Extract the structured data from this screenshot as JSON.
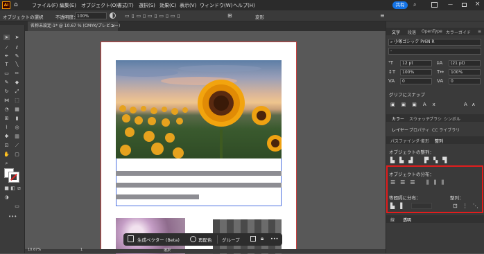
{
  "menu": {
    "app_icon": "Ai",
    "items": [
      "ファイル(F)",
      "編集(E)",
      "オブジェクト(O)",
      "書式(T)",
      "選択(S)",
      "効果(C)",
      "表示(V)",
      "ウィンドウ(W)",
      "ヘルプ(H)"
    ],
    "share": "共有",
    "grid_icon": "grid-icon"
  },
  "control": {
    "selection_label": "オブジェクトの選択",
    "opacity_label": "不透明度：",
    "opacity_value": "100%",
    "transform_label": "変形"
  },
  "document": {
    "tab_title": "名称未設定-1* @ 10.67 % (CMYK/プレビュー)",
    "close": "×"
  },
  "toolbar": {
    "more": "•••"
  },
  "context_bar": {
    "generate": "生成ベクター (Beta)",
    "recolor": "再配色",
    "group": "グループ",
    "more": "•••"
  },
  "status": {
    "zoom": "10.67%",
    "page": "1",
    "mode": "選択"
  },
  "panel": {
    "tabs1": [
      "文字",
      "段落",
      "OpenType",
      "カラーガイド"
    ],
    "font_name": "小塚ゴシック Pr6N R",
    "font_style": "-",
    "size": "12 pt",
    "leading": "(21 pt)",
    "vscale": "100%",
    "hscale": "100%",
    "kern": "0",
    "track": "0",
    "glyph_snap": "グリフにスナップ",
    "tabs2": [
      "カラー",
      "スウォッチ",
      "ブラシ",
      "シンボル"
    ],
    "tabs3": [
      "レイヤー",
      "プロパティ",
      "CC ライブラリ"
    ],
    "tabs4": [
      "パスファインダー",
      "変形",
      "整列"
    ],
    "align_objects": "オブジェクトの整列：",
    "distribute_objects": "オブジェクトの分布：",
    "distribute_spacing": "等間隔に分布：",
    "align_to": "整列：",
    "tabs5": [
      "線",
      "透明"
    ]
  }
}
